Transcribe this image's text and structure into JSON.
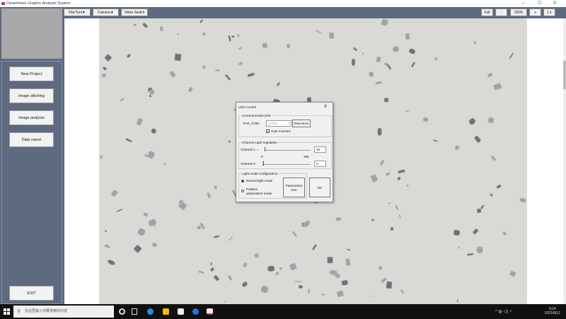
{
  "window": {
    "title": "Cleanliness Graphic Analysis System",
    "minimize": "–",
    "maximize": "☐",
    "close": "X"
  },
  "sidebar": {
    "buttons": [
      "New Project",
      "Image stitching",
      "Image analysis",
      "Data report"
    ],
    "exit": "EXIT"
  },
  "toolbar": {
    "file_tool": "File/Tool▼",
    "camera": "Camera▼",
    "video_switch": "Video Switch",
    "full": "Full",
    "zoom_out": "-",
    "zoom_level": "100%",
    "zoom_in": "+",
    "one_to_one": "1:1"
  },
  "dialog": {
    "title": "LED Control",
    "close": "X",
    "comm": {
      "caption": "Communication link",
      "port_label": "Port_COM:",
      "port_value": "COM5",
      "disconnect": "Disconnec",
      "auto_connect": "Auto Connect",
      "auto_connect_checked": true
    },
    "channel": {
      "caption": "Channel  Light regulation",
      "ch1_label": "Channel 1 ~",
      "ch1_value": "10",
      "min": "0",
      "max": "255",
      "ch2_label": "Channel 2",
      "ch2_value": "0"
    },
    "mode": {
      "caption": "Light mode configuration",
      "normal": "Normal light mode",
      "normal_selected": true,
      "positive_line1": "Positive",
      "positive_line2": "polarization mode",
      "params_lock_1": "Parameters",
      "params_lock_2": "lock",
      "ok": "OK"
    }
  },
  "taskbar": {
    "search_placeholder": "在这里输入你要搜索的内容",
    "time": "9:24",
    "date": "2021/8/12"
  }
}
